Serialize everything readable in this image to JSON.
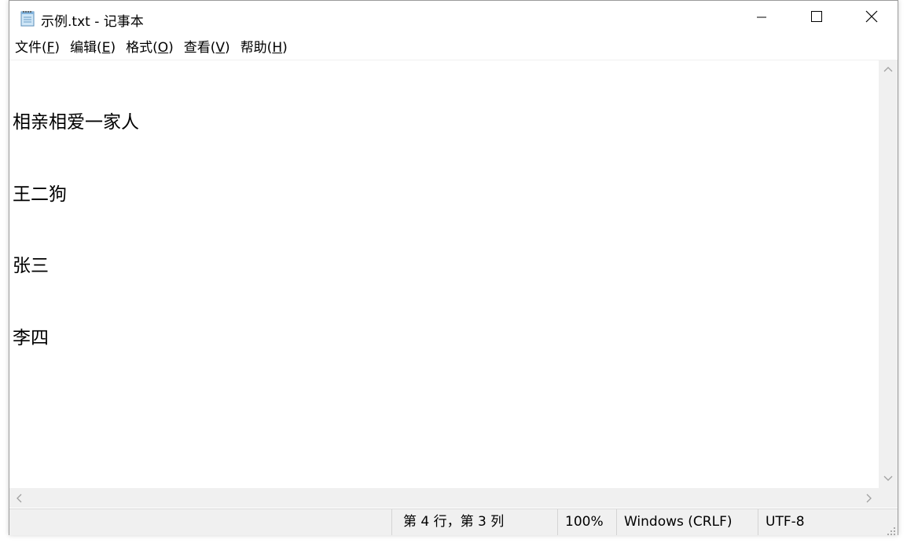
{
  "window": {
    "title": "示例.txt - 记事本"
  },
  "menu": [
    {
      "label": "文件(",
      "key": "F",
      "tail": ")"
    },
    {
      "label": "编辑(",
      "key": "E",
      "tail": ")"
    },
    {
      "label": "格式(",
      "key": "O",
      "tail": ")"
    },
    {
      "label": "查看(",
      "key": "V",
      "tail": ")"
    },
    {
      "label": "帮助(",
      "key": "H",
      "tail": ")"
    }
  ],
  "editor": {
    "lines": [
      "相亲相爱一家人",
      "王二狗",
      "张三",
      "李四"
    ]
  },
  "status": {
    "position": "第 4 行，第 3 列",
    "zoom": "100%",
    "line_ending": "Windows (CRLF)",
    "encoding": "UTF-8"
  },
  "icons": {
    "app": "notepad-icon",
    "minimize": "minimize-icon",
    "maximize": "maximize-icon",
    "close": "close-icon"
  },
  "colors": {
    "chrome": "#f0f0f0",
    "text": "#000000",
    "border": "#9a9a9a"
  }
}
